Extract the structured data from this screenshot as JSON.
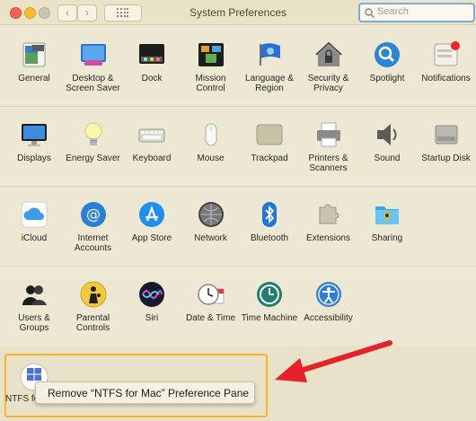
{
  "window": {
    "title": "System Preferences",
    "back_label": "‹",
    "forward_label": "›",
    "search_placeholder": "Search"
  },
  "rows": [
    [
      {
        "name": "general",
        "label": "General",
        "icon": "general-icon"
      },
      {
        "name": "desktop-screen-saver",
        "label": "Desktop & Screen Saver",
        "icon": "desktop-icon"
      },
      {
        "name": "dock",
        "label": "Dock",
        "icon": "dock-icon"
      },
      {
        "name": "mission-control",
        "label": "Mission Control",
        "icon": "mission-control-icon"
      },
      {
        "name": "language-region",
        "label": "Language & Region",
        "icon": "flag-icon"
      },
      {
        "name": "security-privacy",
        "label": "Security & Privacy",
        "icon": "house-lock-icon"
      },
      {
        "name": "spotlight",
        "label": "Spotlight",
        "icon": "magnifier-icon"
      },
      {
        "name": "notifications",
        "label": "Notifications",
        "icon": "notifications-icon"
      }
    ],
    [
      {
        "name": "displays",
        "label": "Displays",
        "icon": "monitor-icon"
      },
      {
        "name": "energy-saver",
        "label": "Energy Saver",
        "icon": "lightbulb-icon"
      },
      {
        "name": "keyboard",
        "label": "Keyboard",
        "icon": "keyboard-icon"
      },
      {
        "name": "mouse",
        "label": "Mouse",
        "icon": "mouse-icon"
      },
      {
        "name": "trackpad",
        "label": "Trackpad",
        "icon": "trackpad-icon"
      },
      {
        "name": "printers-scanners",
        "label": "Printers & Scanners",
        "icon": "printer-icon"
      },
      {
        "name": "sound",
        "label": "Sound",
        "icon": "speaker-icon"
      },
      {
        "name": "startup-disk",
        "label": "Startup Disk",
        "icon": "disk-icon"
      }
    ],
    [
      {
        "name": "icloud",
        "label": "iCloud",
        "icon": "cloud-icon"
      },
      {
        "name": "internet-accounts",
        "label": "Internet Accounts",
        "icon": "at-sign-icon"
      },
      {
        "name": "app-store",
        "label": "App Store",
        "icon": "app-store-icon"
      },
      {
        "name": "network",
        "label": "Network",
        "icon": "globe-icon"
      },
      {
        "name": "bluetooth",
        "label": "Bluetooth",
        "icon": "bluetooth-icon"
      },
      {
        "name": "extensions",
        "label": "Extensions",
        "icon": "puzzle-icon"
      },
      {
        "name": "sharing",
        "label": "Sharing",
        "icon": "folder-share-icon"
      }
    ],
    [
      {
        "name": "users-groups",
        "label": "Users & Groups",
        "icon": "users-icon"
      },
      {
        "name": "parental-controls",
        "label": "Parental Controls",
        "icon": "parental-icon"
      },
      {
        "name": "siri",
        "label": "Siri",
        "icon": "siri-icon"
      },
      {
        "name": "date-time",
        "label": "Date & Time",
        "icon": "clock-calendar-icon"
      },
      {
        "name": "time-machine",
        "label": "Time Machine",
        "icon": "time-machine-icon"
      },
      {
        "name": "accessibility",
        "label": "Accessibility",
        "icon": "accessibility-icon"
      }
    ]
  ],
  "other": {
    "ntfs_label": "NTFS for Mac",
    "context_menu_item": "Remove “NTFS for Mac” Preference Pane"
  },
  "colors": {
    "highlight_border": "#f7b52c",
    "arrow": "#e8202a",
    "window_bg": "#ece8d3"
  }
}
